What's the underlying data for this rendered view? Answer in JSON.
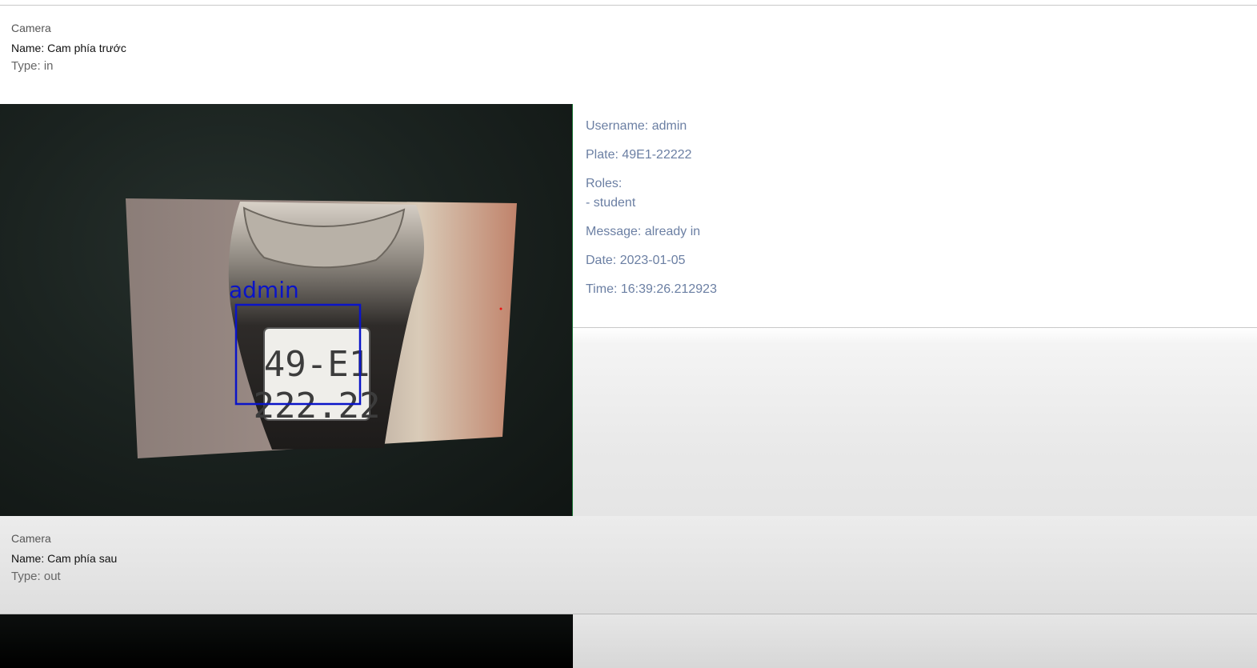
{
  "cameras": [
    {
      "section_label": "Camera",
      "name": "Name: Cam phía trước",
      "type": "Type: in"
    },
    {
      "section_label": "Camera",
      "name": "Name: Cam phía sau",
      "type": "Type: out"
    }
  ],
  "detection": {
    "overlay_label": "admin",
    "plate_line1": "49-E1",
    "plate_line2": "222.22",
    "username": "Username: admin",
    "plate": "Plate: 49E1-22222",
    "roles_label": "Roles:",
    "roles": [
      "- student"
    ],
    "message": "Message: already in",
    "date": "Date: 2023-01-05",
    "time": "Time: 16:39:26.212923"
  },
  "colors": {
    "info_text": "#6b7fa3",
    "overlay_box": "#0a14c8",
    "feed_border": "#1f7a3a"
  }
}
